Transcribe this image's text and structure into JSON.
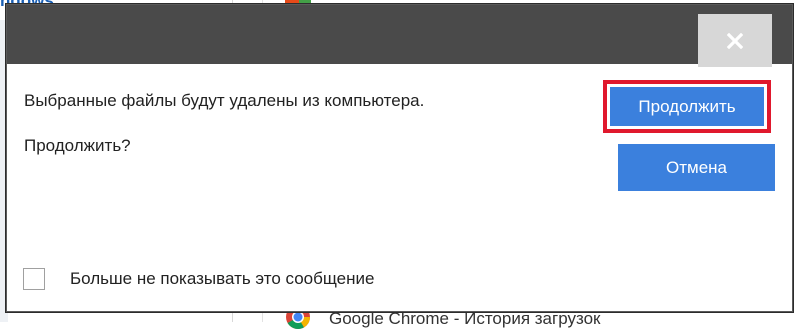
{
  "background": {
    "top_text": "ndows",
    "bottom_item_text": "Google Chrome - История загрузок",
    "bottom_item_icon": "chrome-icon"
  },
  "dialog": {
    "close_icon": "close-icon",
    "message": "Выбранные файлы будут удалены из компьютера.",
    "question": "Продолжить?",
    "continue_label": "Продолжить",
    "cancel_label": "Отмена",
    "dont_show_label": "Больше не показывать это сообщение",
    "dont_show_checked": false
  },
  "colors": {
    "titlebar": "#4a4a4a",
    "close_button_bg": "#d7d7d7",
    "button_blue": "#3b80dd",
    "highlight_red": "#e0182d"
  }
}
